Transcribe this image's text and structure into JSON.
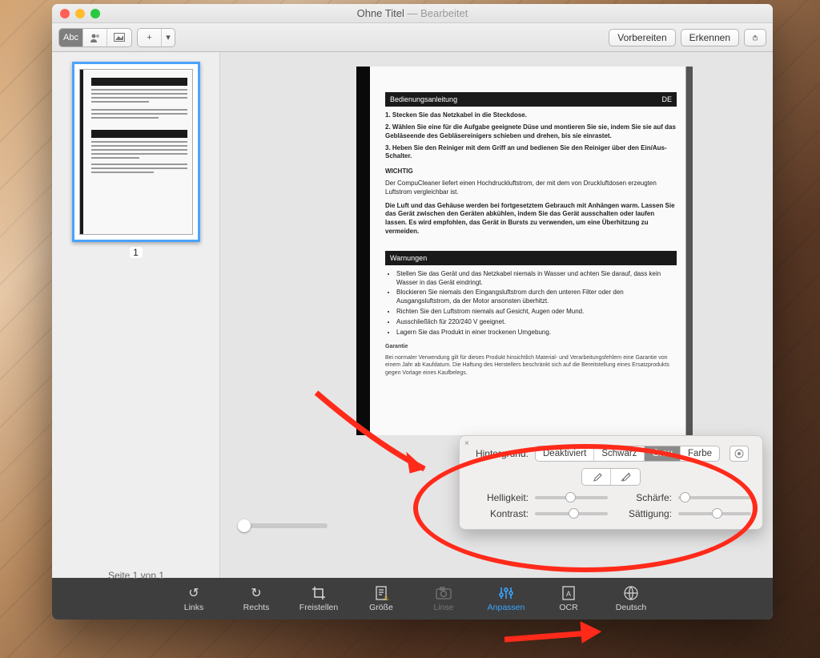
{
  "title": {
    "main": "Ohne Titel",
    "suffix": " — Bearbeitet"
  },
  "toolbar": {
    "abc": "Abc",
    "vorbereiten": "Vorbereiten",
    "erkennen": "Erkennen"
  },
  "sidebar": {
    "pagenum": "1",
    "footer": "Seite 1 von 1"
  },
  "doc": {
    "h1": "Bedienungsanleitung",
    "h1r": "DE",
    "l1": "1. Stecken Sie das Netzkabel in die Steckdose.",
    "l2": "2. Wählen Sie eine für die Aufgabe geeignete Düse und montieren Sie sie, indem Sie sie auf das Gebläseende des Gebläsereinigers schieben und drehen, bis sie einrastet.",
    "l3": "3. Heben Sie den Reiniger mit dem Griff an und bedienen Sie den Reiniger über den Ein/Aus-Schalter.",
    "wt": "WICHTIG",
    "w1": "Der CompuCleaner liefert einen Hochdruckluftstrom, der mit dem von Druckluftdosen erzeugten Luftstrom vergleichbar ist.",
    "w2": "Die Luft und das Gehäuse werden bei fortgesetztem Gebrauch mit Anhängen warm. Lassen Sie das Gerät zwischen den Geräten abkühlen, indem Sie das Gerät ausschalten oder laufen lassen. Es wird empfohlen, das Gerät in Bursts zu verwenden, um eine Überhitzung zu vermeiden.",
    "h2": "Warnungen",
    "b1": "Stellen Sie das Gerät und das Netzkabel niemals in Wasser und achten Sie darauf, dass kein Wasser in das Gerät eindringt.",
    "b2": "Blockieren Sie niemals den Eingangsluftstrom durch den unteren Filter oder den Ausgangsluftstrom, da der Motor ansonsten überhitzt.",
    "b3": "Richten Sie den Luftstrom niemals auf Gesicht, Augen oder Mund.",
    "b4": "Ausschließlich für 220/240 V geeignet.",
    "b5": "Lagern Sie das Produkt in einer trockenen Umgebung.",
    "gt": "Garantie",
    "g1": "Bei normaler Verwendung gilt für dieses Produkt hinsichtlich Material- und Verarbeitungsfehlern eine Garantie von einem Jahr ab Kaufdatum. Die Haftung des Herstellers beschränkt sich auf die Bereitstellung eines Ersatzprodukts gegen Vorlage eines Kaufbelegs."
  },
  "popover": {
    "bg": "Hintergrund:",
    "opts": {
      "off": "Deaktiviert",
      "black": "Schwarz",
      "gray": "Grau",
      "color": "Farbe"
    },
    "helligkeit": "Helligkeit:",
    "kontrast": "Kontrast:",
    "schaerfe": "Schärfe:",
    "saettigung": "Sättigung:"
  },
  "bottom": {
    "links": "Links",
    "rechts": "Rechts",
    "freistellen": "Freistellen",
    "groesse": "Größe",
    "linse": "Linse",
    "anpassen": "Anpassen",
    "ocr": "OCR",
    "deutsch": "Deutsch"
  }
}
